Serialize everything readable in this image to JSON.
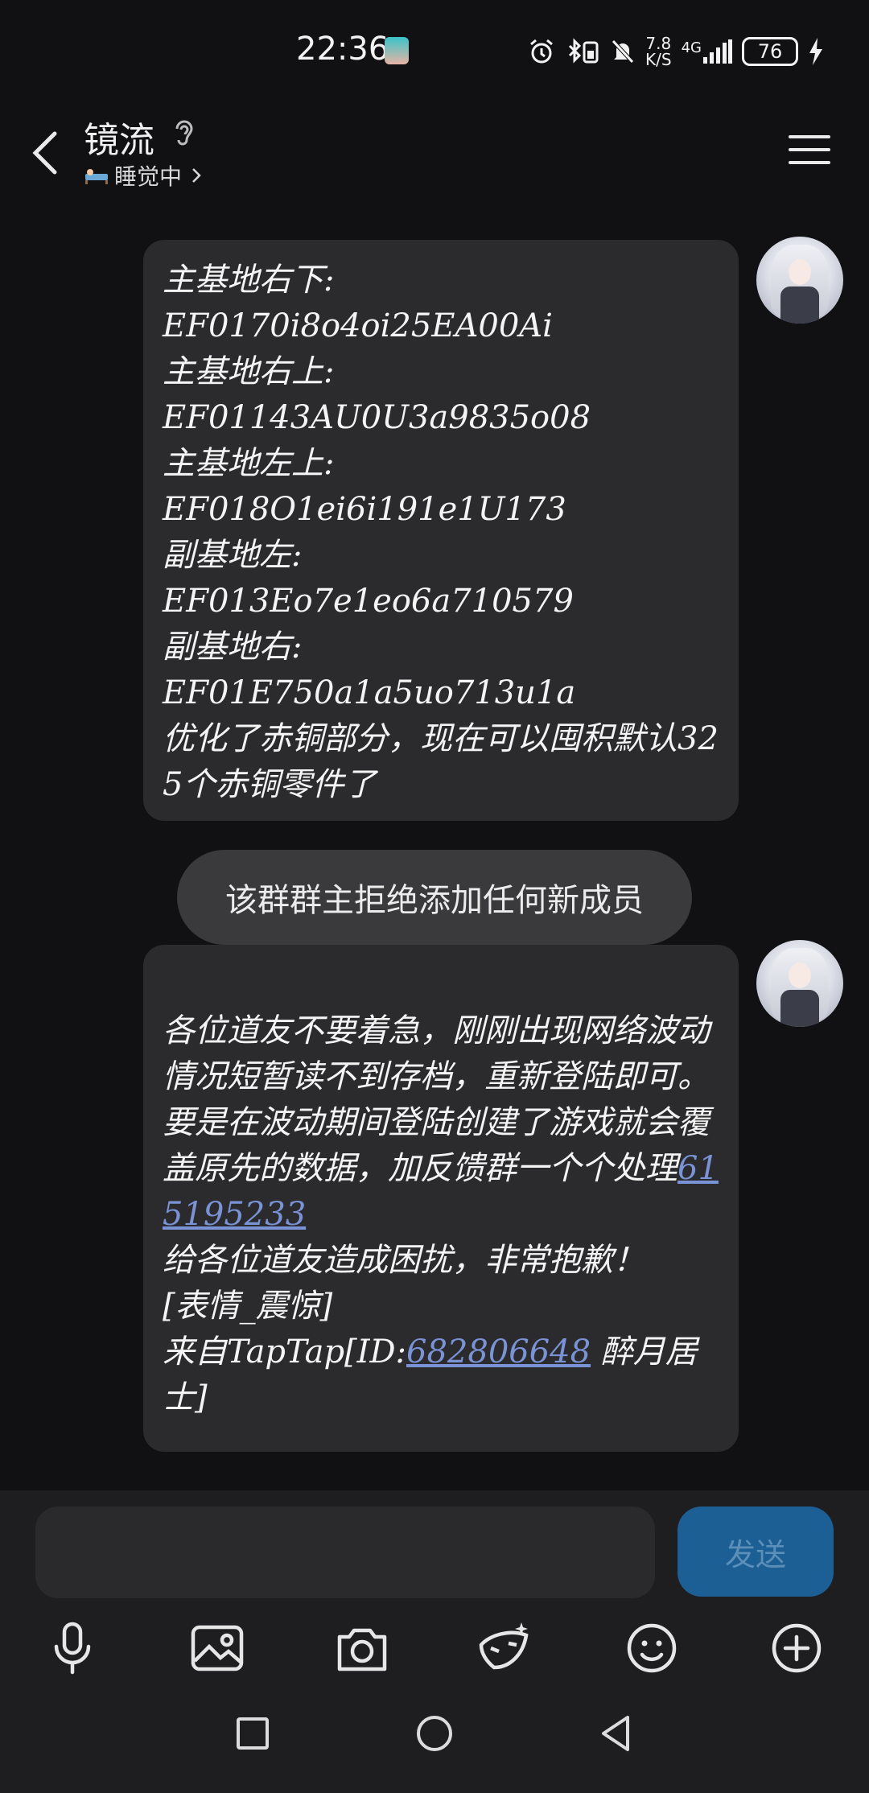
{
  "status_bar": {
    "time": "22:36",
    "net_speed_top": "7.8",
    "net_speed_bottom": "K/S",
    "network": "4G",
    "battery": "76"
  },
  "header": {
    "title": "镜流",
    "status_text": "睡觉中"
  },
  "messages": [
    {
      "type": "incoming",
      "text": "主基地右下:\nEF0170i8o4oi25EA00Ai\n主基地右上:\nEF01143AU0U3a9835o08\n主基地左上:\nEF018O1ei6i191e1U173\n副基地左:\nEF013Eo7e1eo6a710579\n副基地右:\nEF01E750a1a5uo713u1a\n优化了赤铜部分，现在可以囤积默认325个赤铜零件了"
    },
    {
      "type": "system",
      "text": "该群群主拒绝添加任何新成员"
    },
    {
      "type": "incoming",
      "text_part1": "\n各位道友不要着急，刚刚出现网络波动情况短暂读不到存档，重新登陆即可。\n要是在波动期间登陆创建了游戏就会覆盖原先的数据，加反馈群一个个处理",
      "link1": "615195233",
      "text_part2": "\n给各位道友造成困扰，非常抱歉！\n[表情_震惊]\n来自TapTap[ID:",
      "link2": "682806648",
      "text_part3": " 醉月居士]"
    }
  ],
  "composer": {
    "input_value": "",
    "send_label": "发送"
  },
  "toolbar_icons": [
    "microphone-icon",
    "image-icon",
    "camera-icon",
    "sticker-icon",
    "emoji-icon",
    "plus-icon"
  ],
  "nav_icons": [
    "recents-square-icon",
    "home-circle-icon",
    "back-triangle-icon"
  ]
}
